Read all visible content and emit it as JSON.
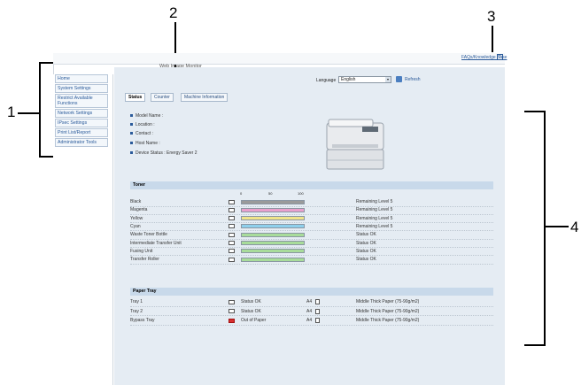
{
  "callouts": [
    "1",
    "2",
    "3",
    "4"
  ],
  "header": {
    "title": "Web Image Monitor",
    "faq_link": "FAQs/Knowledge Base",
    "help_icon": "help-icon",
    "help_label": "?"
  },
  "nav": {
    "items": [
      "Home",
      "System Settings",
      "Restrict Available Functions",
      "Network Settings",
      "IPsec Settings",
      "Print List/Report",
      "Administrator Tools"
    ]
  },
  "tabs": [
    "Status",
    "Counter",
    "Machine Information"
  ],
  "language": {
    "label": "Language",
    "value": "English",
    "refresh_label": "Refresh"
  },
  "device_info": [
    {
      "label": "Model Name",
      "value": ""
    },
    {
      "label": "Location",
      "value": ""
    },
    {
      "label": "Contact",
      "value": ""
    },
    {
      "label": "Host Name",
      "value": ""
    },
    {
      "label": "Device Status",
      "value": "Energy Saver 2"
    }
  ],
  "toner": {
    "title": "Toner",
    "scale": [
      "0",
      "50",
      "100"
    ],
    "rows": [
      {
        "label": "Black",
        "status": "Remaining Level 5",
        "color": "#9a9a9a",
        "level": 1.0
      },
      {
        "label": "Magenta",
        "status": "Remaining Level 5",
        "color": "#e9a0cc",
        "level": 1.0
      },
      {
        "label": "Yellow",
        "status": "Remaining Level 5",
        "color": "#efe48a",
        "level": 1.0
      },
      {
        "label": "Cyan",
        "status": "Remaining Level 5",
        "color": "#8fd0ec",
        "level": 1.0
      },
      {
        "label": "Waste Toner Bottle",
        "status": "Status OK",
        "color": "#a8dc9a",
        "level": 1.0
      },
      {
        "label": "Intermediate Transfer Unit",
        "status": "Status OK",
        "color": "#a8dc9a",
        "level": 1.0
      },
      {
        "label": "Fusing Unit",
        "status": "Status OK",
        "color": "#a8dc9a",
        "level": 1.0
      },
      {
        "label": "Transfer Roller",
        "status": "Status OK",
        "color": "#a8dc9a",
        "level": 1.0
      }
    ]
  },
  "paper_tray": {
    "title": "Paper Tray",
    "rows": [
      {
        "label": "Tray 1",
        "status": "Status OK",
        "size": "A4",
        "type": "Middle Thick Paper (75-90g/m2)"
      },
      {
        "label": "Tray 2",
        "status": "Status OK",
        "size": "A4",
        "type": "Middle Thick Paper (75-90g/m2)"
      },
      {
        "label": "Bypass Tray",
        "status": "Out of Paper",
        "size": "A4",
        "type": "Middle Thick Paper (75-90g/m2)"
      }
    ]
  },
  "colors": {
    "panel": "#e5ecf3",
    "section": "#c8d9ea",
    "link": "#2a5a9a",
    "error": "#d93030"
  }
}
